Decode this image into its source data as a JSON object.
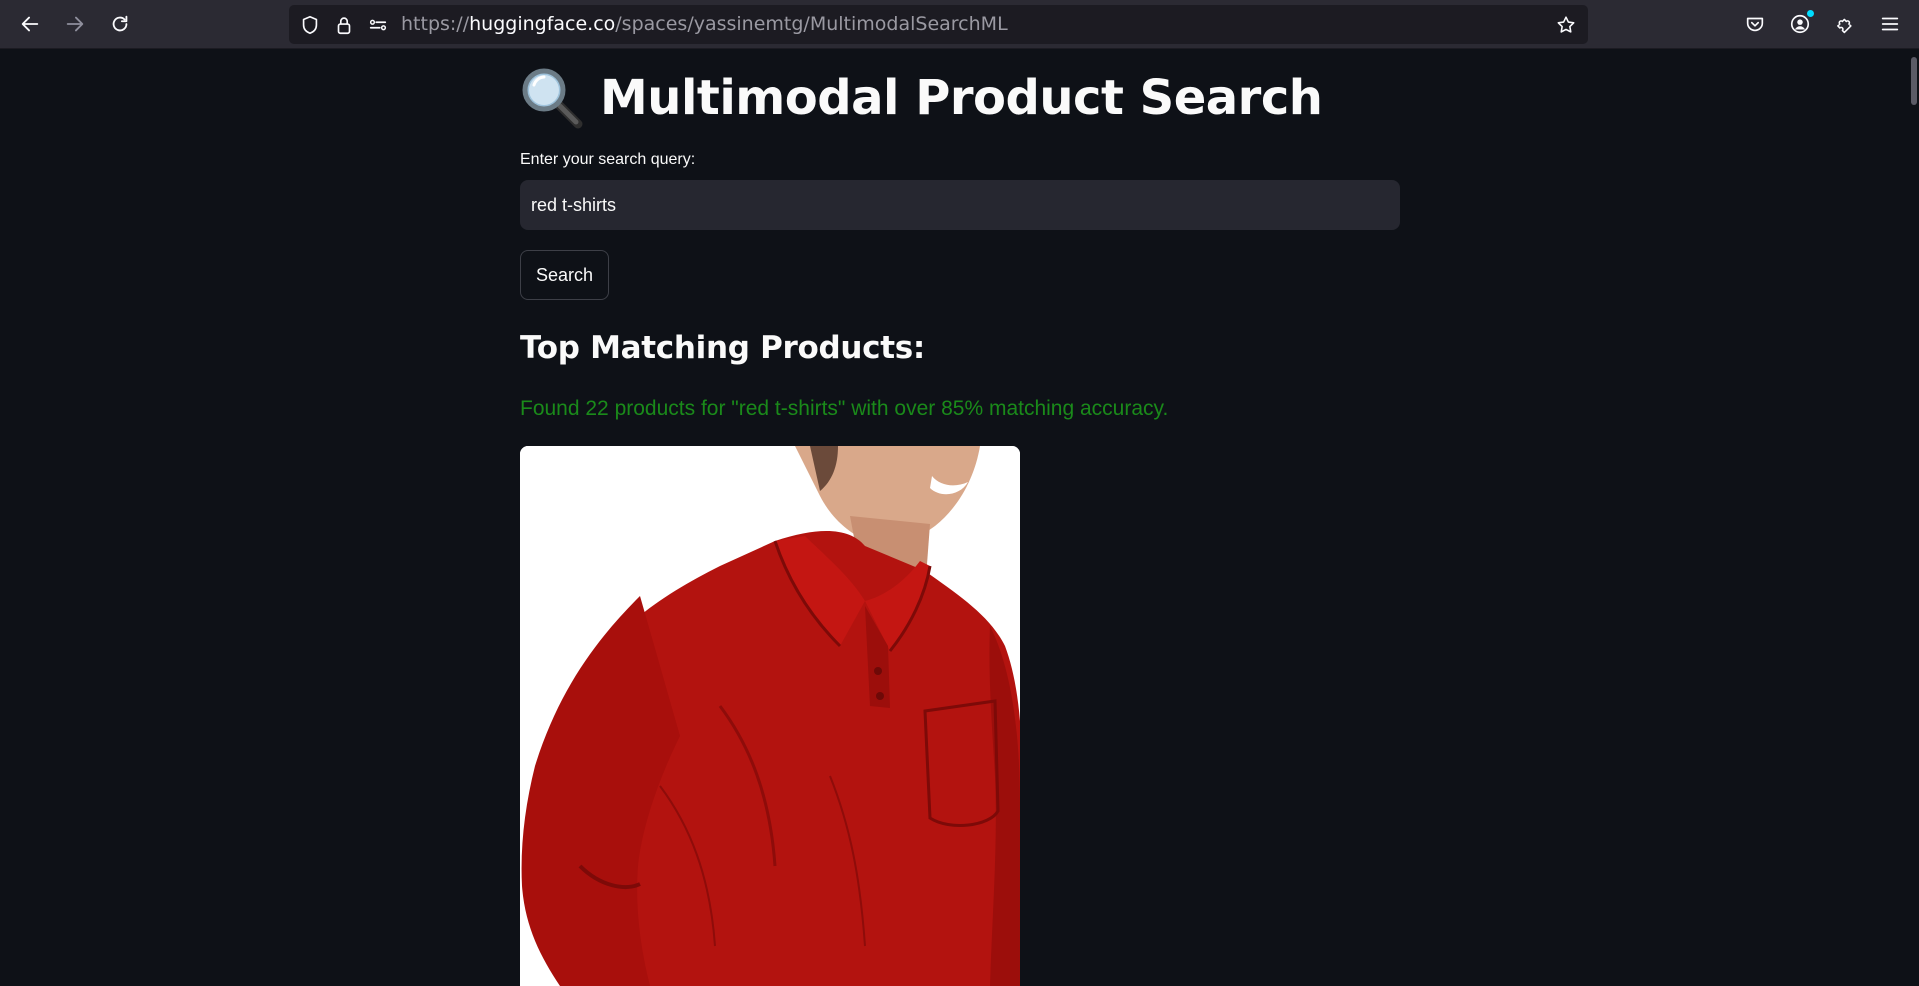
{
  "browser": {
    "url_scheme": "https://",
    "url_host": "huggingface.co",
    "url_path": "/spaces/yassinemtg/MultimodalSearchML",
    "icons": [
      "back-arrow-icon",
      "forward-arrow-icon",
      "reload-icon",
      "shield-icon",
      "lock-icon",
      "permissions-icon",
      "bookmark-star-icon",
      "pocket-icon",
      "account-icon",
      "extensions-icon",
      "menu-icon"
    ]
  },
  "page": {
    "title": "Multimodal Product Search",
    "title_icon": "magnifying-glass-icon",
    "query_label": "Enter your search query:",
    "query_value": "red t-shirts",
    "search_button_label": "Search",
    "results_heading": "Top Matching Products:",
    "results_message": "Found 22 products for \"red t-shirts\" with over 85% matching accuracy.",
    "results_message_color": "#1a8a1a",
    "product_image_alt": "red long-sleeve polo shirt"
  },
  "colors": {
    "background": "#0e1117",
    "input_background": "#262730",
    "text": "#fafafa",
    "toolbar": "#2b2a33"
  }
}
